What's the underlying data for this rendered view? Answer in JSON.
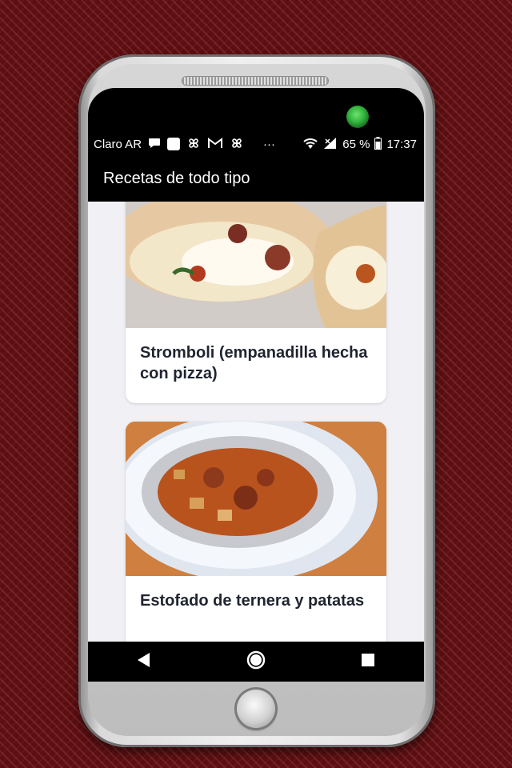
{
  "status_bar": {
    "carrier": "Claro AR",
    "dots": "···",
    "battery": "65 %",
    "time": "17:37",
    "icons": [
      "chat-bubble-icon",
      "app-square-icon",
      "pinwheel-icon",
      "gmail-icon",
      "pinwheel-icon",
      "wifi-icon",
      "signal-icon"
    ]
  },
  "toolbar": {
    "title": "Recetas de todo tipo"
  },
  "recipes": [
    {
      "title": "Stromboli (empanadilla hecha con pizza)",
      "image": "stromboli-photo"
    },
    {
      "title": "Estofado de ternera y patatas",
      "image": "beef-stew-photo"
    }
  ],
  "nav": {
    "back": "back-icon",
    "home": "home-icon",
    "recents": "recents-icon"
  },
  "colors": {
    "background": "#5a0f12",
    "bar": "#000000",
    "screen_bg": "#f1f0f5",
    "title_text": "#1f2430",
    "camera": "#2fb03a"
  }
}
